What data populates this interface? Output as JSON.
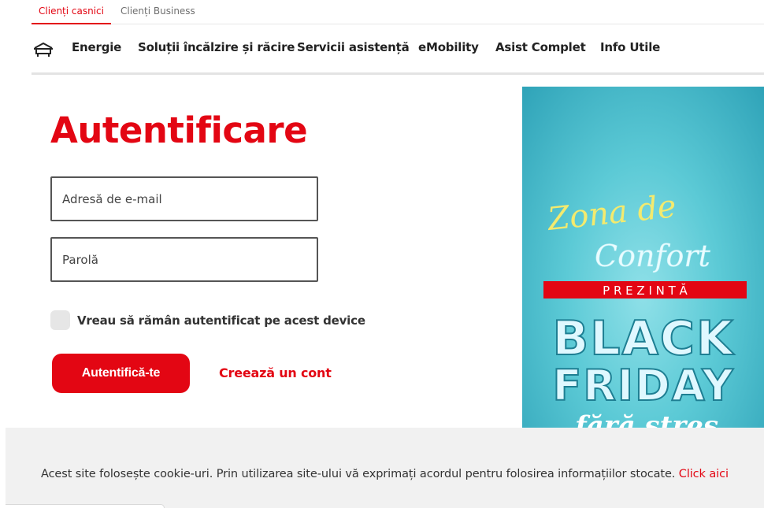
{
  "top_tabs": {
    "residential": "Clienți casnici",
    "business": "Clienți Business"
  },
  "nav": {
    "logo_icon": "house-icon",
    "items": [
      "Energie",
      "Soluții încălzire și răcire",
      "Servicii asistență",
      "eMobility",
      "Asist Complet",
      "Info Utile"
    ]
  },
  "login": {
    "title": "Autentificare",
    "email_placeholder": "Adresă de e-mail",
    "password_placeholder": "Parolă",
    "remember_label": "Vreau să rămân autentificat pe acest device",
    "remember_checked": false,
    "submit_label": "Autentifică-te",
    "create_account_label": "Creează un cont"
  },
  "banner": {
    "line1": "Zona de",
    "line2": "Confort",
    "ribbon": "P R E Z I N T Ă",
    "headline1": "BLACK",
    "headline2": "FRIDAY",
    "tagline": "fără stres"
  },
  "cookie": {
    "text": "Acest site folosește cookie-uri. Prin utilizarea site-ului vă exprimați acordul pentru folosirea informațiilor stocate. ",
    "link": "Click aici"
  },
  "colors": {
    "brand_red": "#e30613",
    "banner_teal": "#5ccad6",
    "cookie_bg": "#f1f1f1"
  }
}
